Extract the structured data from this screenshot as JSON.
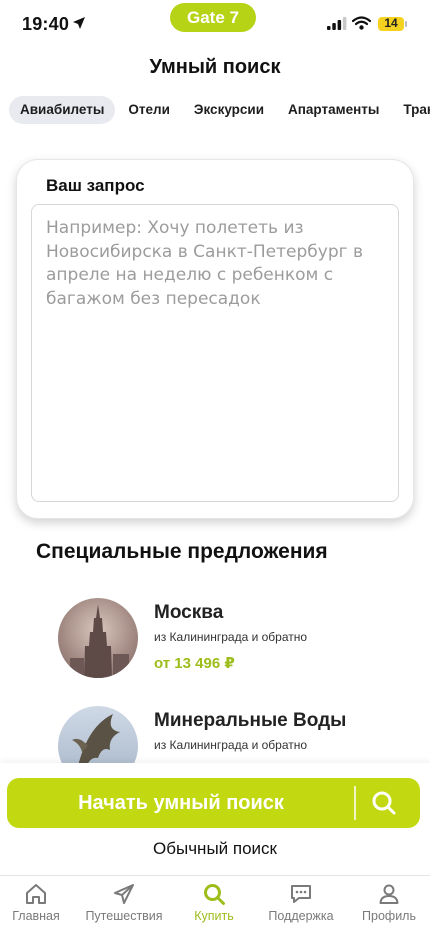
{
  "status_bar": {
    "time": "19:40",
    "pill": "Gate 7",
    "battery": "14"
  },
  "page": {
    "title": "Умный поиск"
  },
  "tabs": [
    {
      "label": "Авиабилеты",
      "active": true
    },
    {
      "label": "Отели"
    },
    {
      "label": "Экскурсии"
    },
    {
      "label": "Апартаменты"
    },
    {
      "label": "Транс"
    }
  ],
  "query": {
    "label": "Ваш запрос",
    "value": "",
    "placeholder": "Например: Хочу полететь из Новосибирска в Санкт-Петербург в апреле на неделю с ребенком с багажом без пересадок"
  },
  "offers_section": {
    "title": "Специальные предложения",
    "items": [
      {
        "city": "Москва",
        "subtitle": "из Калининграда и обратно",
        "price": "от 13 496 ₽"
      },
      {
        "city": "Минеральные Воды",
        "subtitle": "из Калининграда и обратно",
        "price": ""
      }
    ]
  },
  "actions": {
    "primary": "Начать умный поиск",
    "secondary": "Обычный поиск"
  },
  "bottom_nav": [
    {
      "label": "Главная",
      "icon": "home-icon"
    },
    {
      "label": "Путешествия",
      "icon": "plane-icon"
    },
    {
      "label": "Купить",
      "icon": "search-icon",
      "active": true
    },
    {
      "label": "Поддержка",
      "icon": "chat-icon"
    },
    {
      "label": "Профиль",
      "icon": "user-icon"
    }
  ],
  "colors": {
    "accent": "#c2d911",
    "price": "#9dbd1a",
    "pill": "#b6d316"
  }
}
